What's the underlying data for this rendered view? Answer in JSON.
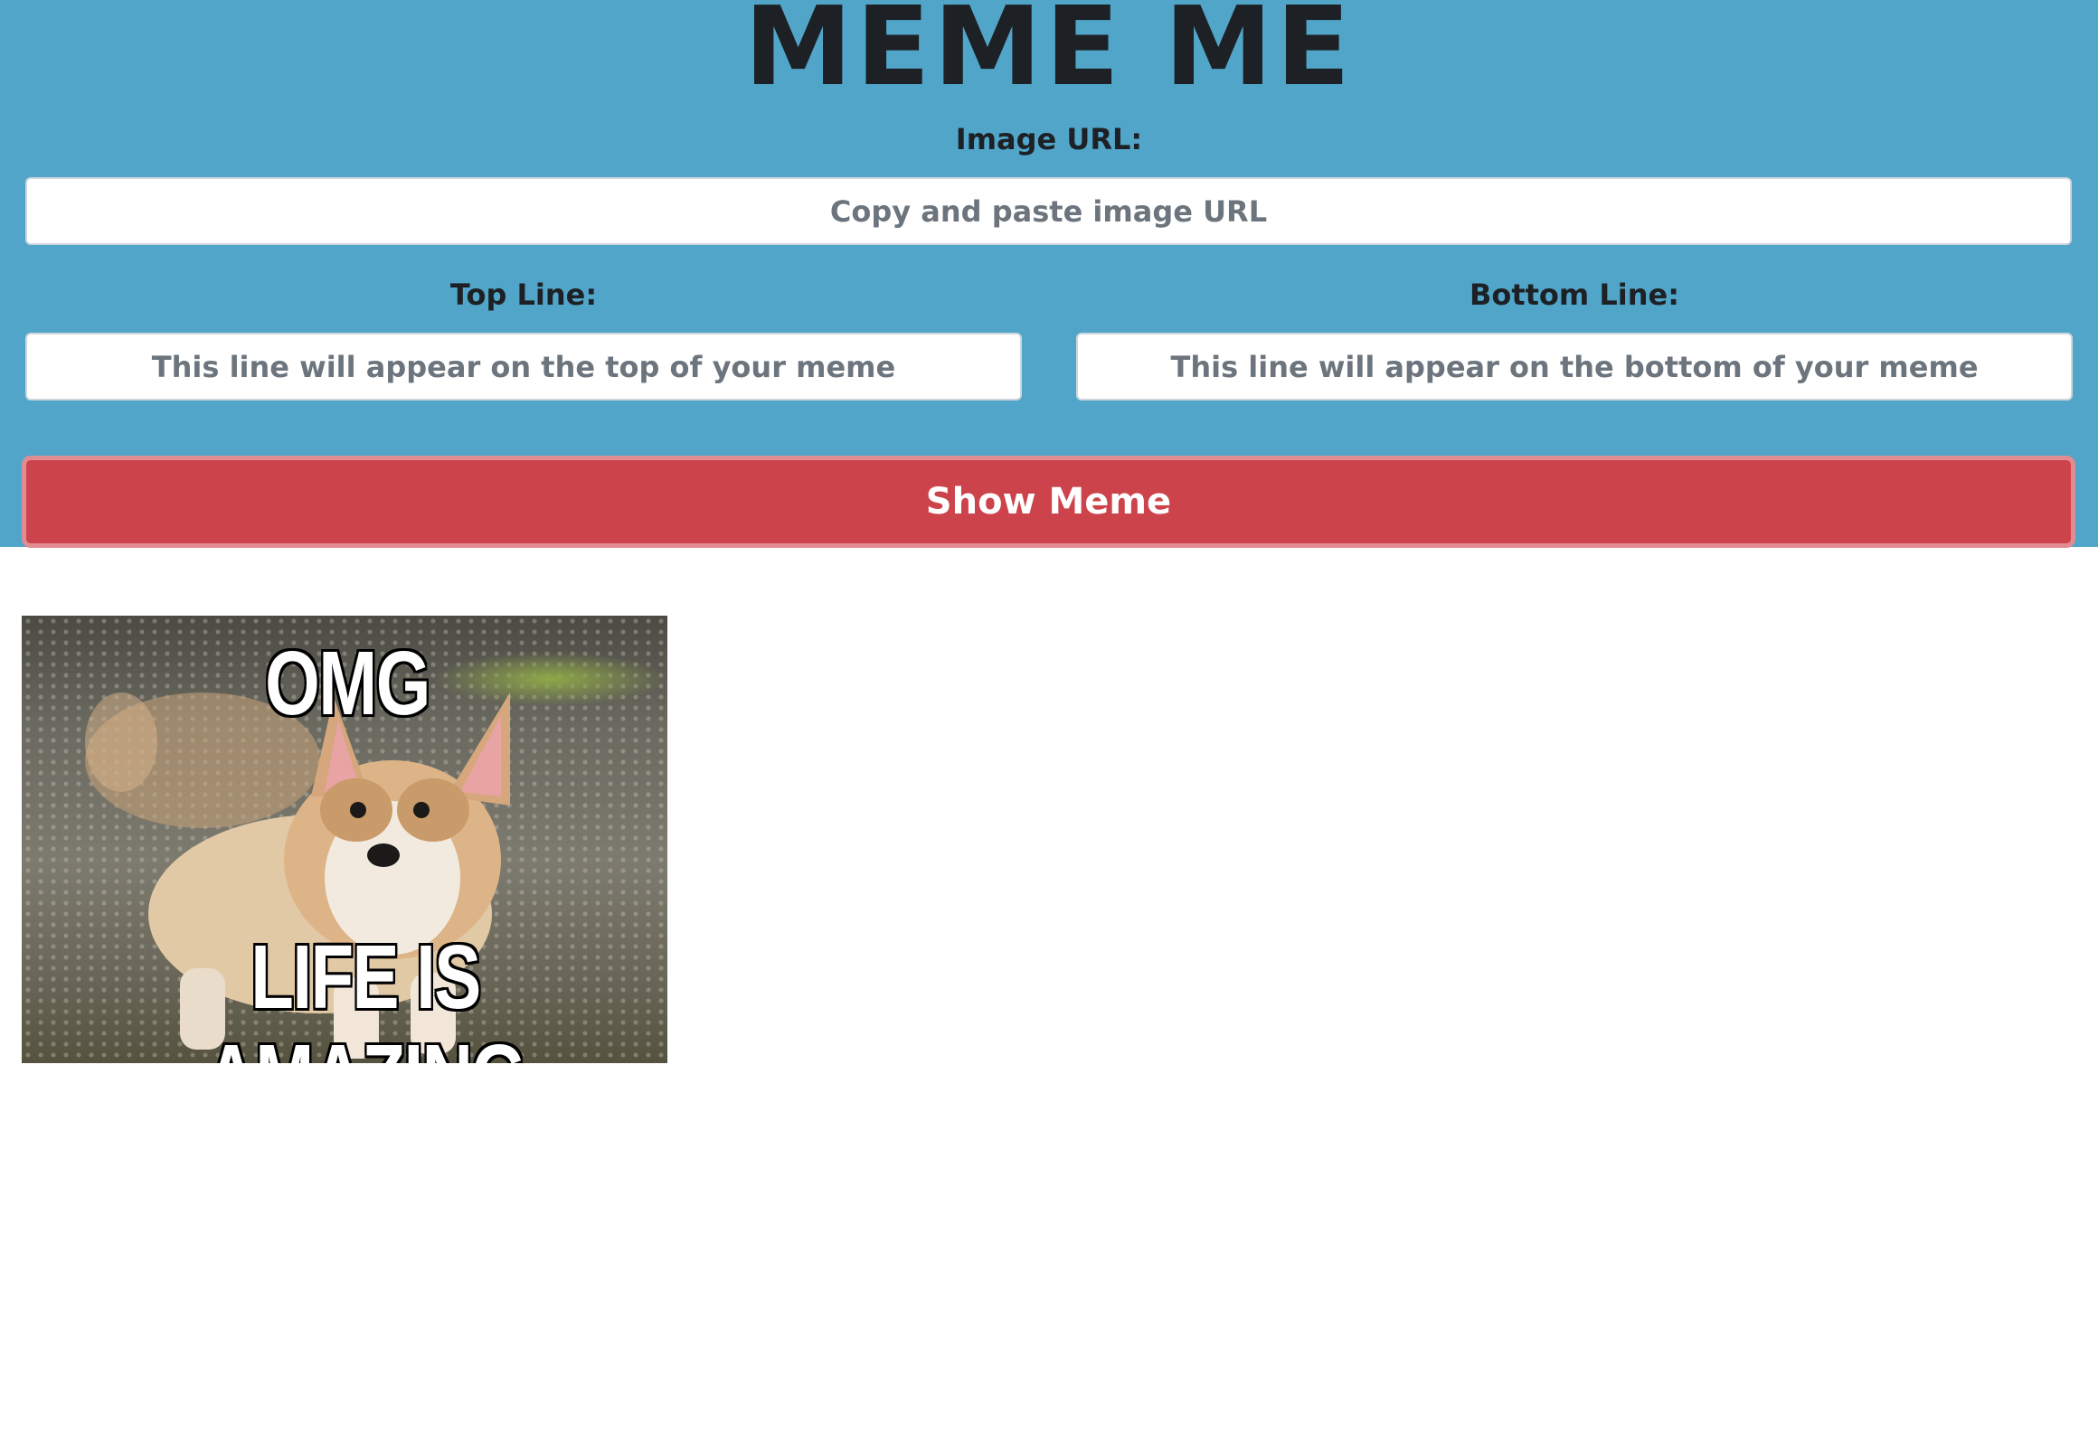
{
  "app": {
    "title": "MEME ME"
  },
  "form": {
    "image_url_label": "Image URL:",
    "image_url_placeholder": "Copy and paste image URL",
    "image_url_value": "",
    "top_line_label": "Top Line:",
    "top_line_placeholder": "This line will appear on the top of your meme",
    "top_line_value": "",
    "bottom_line_label": "Bottom Line:",
    "bottom_line_placeholder": "This line will appear on the bottom of your meme",
    "bottom_line_value": "",
    "submit_label": "Show Meme"
  },
  "meme": {
    "top_text": "OMG",
    "bottom_text": "LIFE IS AMAZING",
    "image_subject": "corgi puppy on gravel"
  },
  "colors": {
    "header_background": "#51a5c9",
    "title_text": "#1d2125",
    "button_background": "#cd434b",
    "button_text": "#ffffff",
    "page_background": "#ffffff"
  }
}
